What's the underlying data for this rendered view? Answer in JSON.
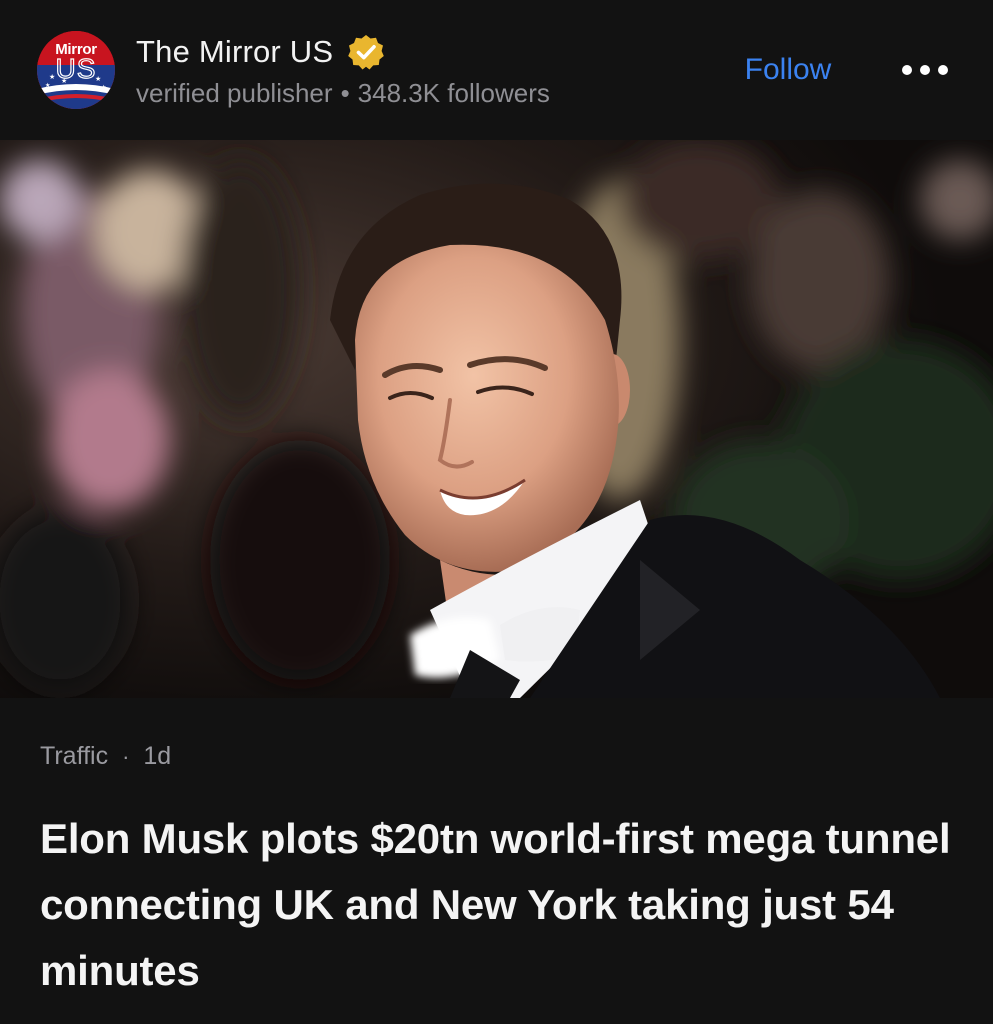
{
  "publisher": {
    "logo_top": "Mirror",
    "logo_bottom": "US",
    "name": "The Mirror US",
    "label": "verified publisher",
    "separator": "•",
    "followers": "348.3K followers",
    "verified_icon": "verified-badge-icon",
    "verified_color": "#e9b62f"
  },
  "actions": {
    "follow_label": "Follow",
    "more_icon": "more-horizontal-icon",
    "accent_color": "#3b82f0"
  },
  "hero": {
    "icon": "photo-man-in-tuxedo"
  },
  "article": {
    "category": "Traffic",
    "separator": "·",
    "age": "1d",
    "headline": "Elon Musk plots $20tn world-first mega tunnel connecting UK and New York taking just 54 minutes"
  }
}
